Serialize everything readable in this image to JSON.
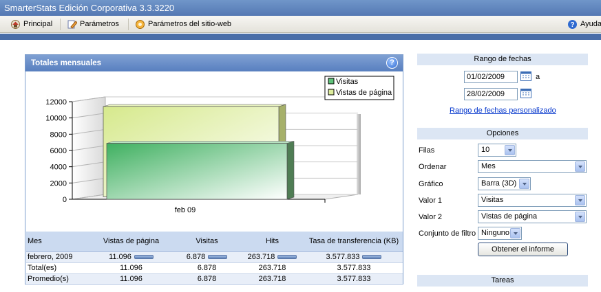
{
  "app": {
    "title": "SmarterStats Edición Corporativa 3.3.3220"
  },
  "toolbar": {
    "principal": "Principal",
    "parametros": "Parámetros",
    "parametros_sitio": "Parámetros del sitio-web",
    "ayuda": "Ayuda"
  },
  "panel": {
    "title": "Totales mensuales"
  },
  "chart_data": {
    "type": "bar",
    "categories": [
      "feb 09"
    ],
    "series": [
      {
        "name": "Visitas",
        "values": [
          6878
        ]
      },
      {
        "name": "Vistas de página",
        "values": [
          11096
        ]
      }
    ],
    "yticks": [
      "0",
      "2000",
      "4000",
      "6000",
      "8000",
      "10000",
      "12000"
    ],
    "ylim": [
      0,
      12000
    ],
    "legend": "top-right",
    "grid": true,
    "style": "3d",
    "colors": {
      "Visitas": "#5fc27a",
      "Vistas de página": "#dcec9c"
    }
  },
  "table": {
    "headers": [
      "Mes",
      "Vistas de página",
      "Visitas",
      "Hits",
      "Tasa de transferencia (KB)"
    ],
    "rows": [
      [
        "febrero, 2009",
        "11.096",
        "6.878",
        "263.718",
        "3.577.833"
      ],
      [
        "Total(es)",
        "11.096",
        "6.878",
        "263.718",
        "3.577.833"
      ],
      [
        "Promedio(s)",
        "11.096",
        "6.878",
        "263.718",
        "3.577.833"
      ]
    ]
  },
  "date_range": {
    "title": "Rango de fechas",
    "from": "01/02/2009",
    "to_label": "a",
    "to": "28/02/2009",
    "custom_link": "Rango de fechas personalizado"
  },
  "options": {
    "title": "Opciones",
    "filas_label": "Filas",
    "filas_value": "10",
    "ordenar_label": "Ordenar",
    "ordenar_value": "Mes",
    "grafico_label": "Gráfico",
    "grafico_value": "Barra (3D)",
    "valor1_label": "Valor 1",
    "valor1_value": "Visitas",
    "valor2_label": "Valor 2",
    "valor2_value": "Vistas de página",
    "filtro_label": "Conjunto de filtro",
    "filtro_value": "Ninguno",
    "submit": "Obtener el informe"
  },
  "tasks": {
    "title": "Tareas"
  }
}
